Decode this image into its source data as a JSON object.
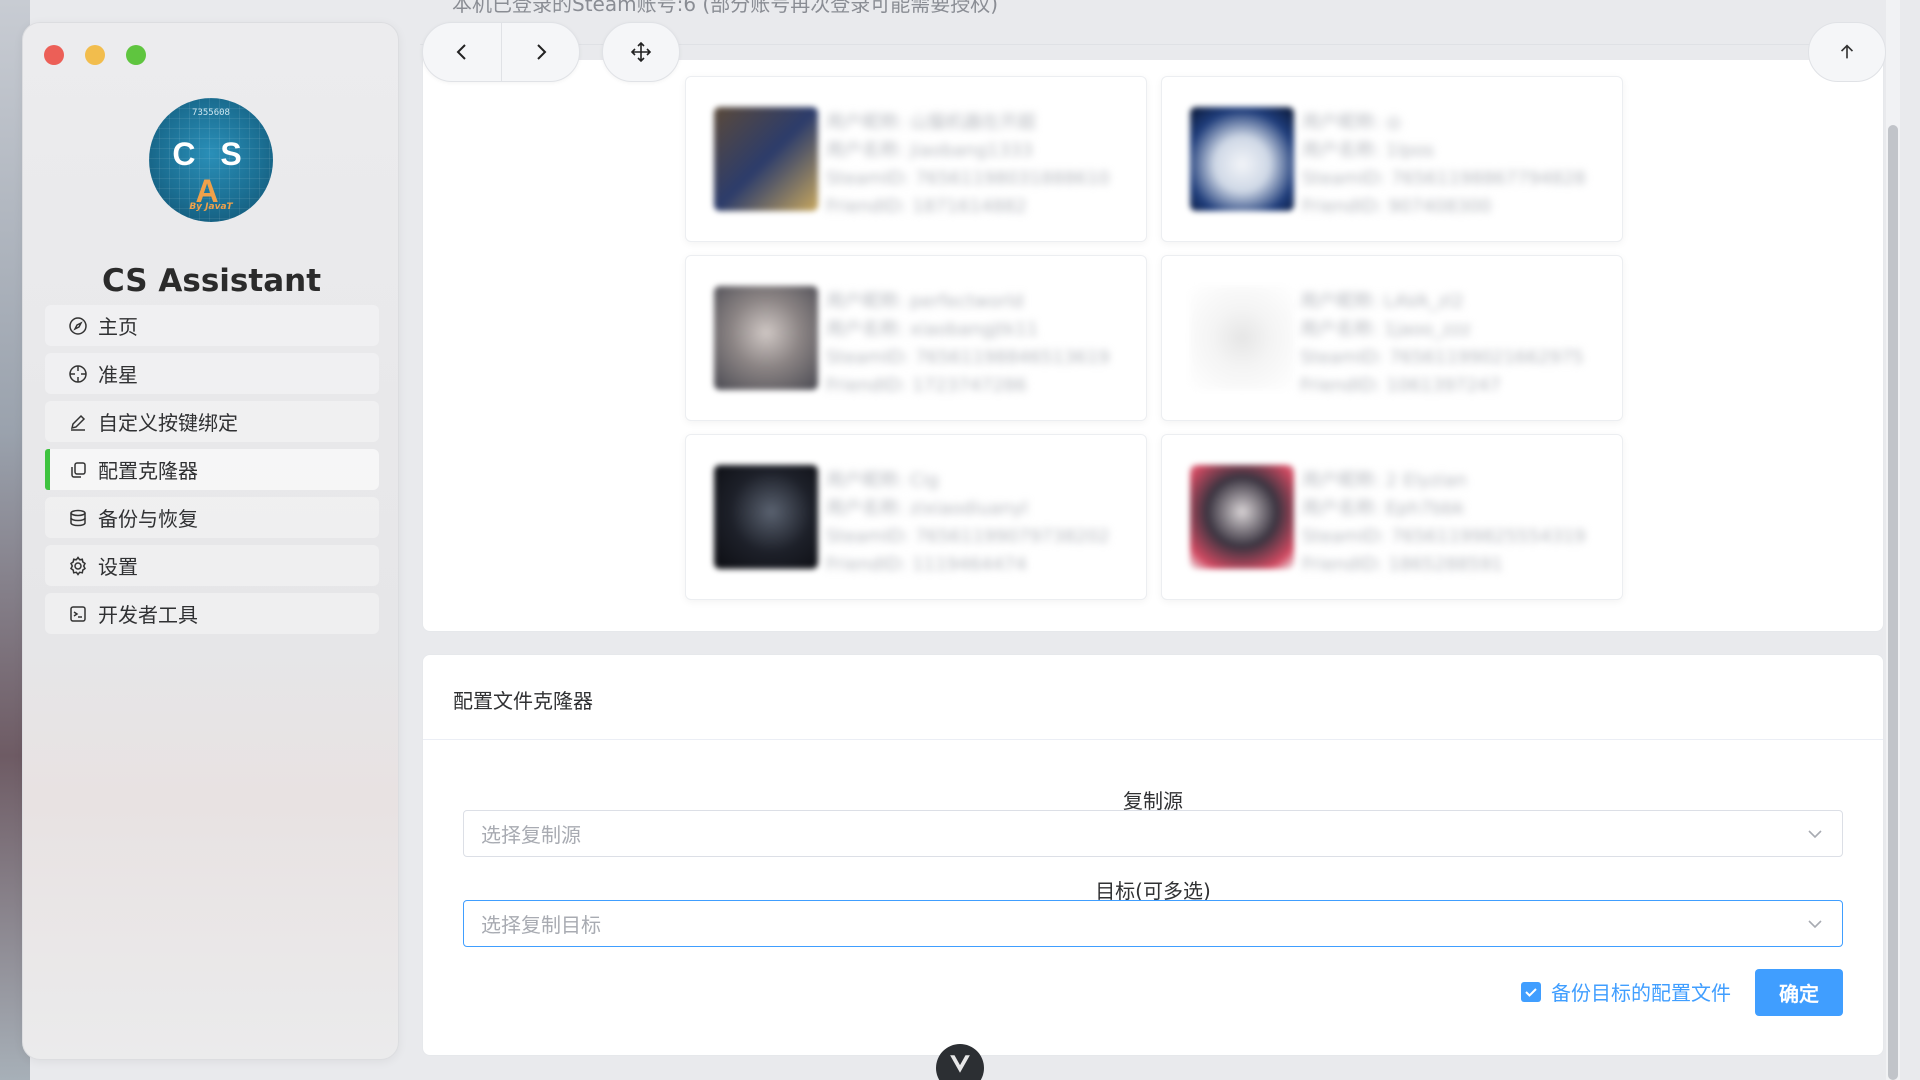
{
  "app": {
    "title": "CS Assistant",
    "logo": {
      "code": "7355608",
      "letters_cs": "C S ",
      "letters_a": "A",
      "byline": "By JavaT"
    }
  },
  "sidebar": {
    "items": [
      {
        "label": "主页",
        "icon": "compass-icon",
        "active": false
      },
      {
        "label": "准星",
        "icon": "crosshair-icon",
        "active": false
      },
      {
        "label": "自定义按键绑定",
        "icon": "pen-icon",
        "active": false
      },
      {
        "label": "配置克隆器",
        "icon": "copy-icon",
        "active": true
      },
      {
        "label": "备份与恢复",
        "icon": "database-icon",
        "active": false
      },
      {
        "label": "设置",
        "icon": "gear-icon",
        "active": false
      },
      {
        "label": "开发者工具",
        "icon": "terminal-icon",
        "active": false
      }
    ]
  },
  "header": {
    "summary": "本机已登录的Steam账号:6 (部分账号再次登录可能需要授权)"
  },
  "accounts": [
    {
      "l1": "用户昵称: 山猫机器在开超",
      "l2": "用户名称: jiaobang1333",
      "l3": "SteamID: 76561198031888610",
      "l4": "FriendID: 1871614882"
    },
    {
      "l1": "用户昵称: ◎",
      "l2": "用户名称: 1lpos",
      "l3": "SteamID: 76561198867794828",
      "l4": "FriendID: 907408300"
    },
    {
      "l1": "用户昵称: perfectworld",
      "l2": "用户名称: xiaobangjtk11",
      "l3": "SteamID: 76561198846513619",
      "l4": "FriendID: 1723747286"
    },
    {
      "l1": "用户昵称: LAVA_zl2",
      "l2": "用户名称: 1jaoo_zzz",
      "l3": "SteamID: 76561199021662975",
      "l4": "FriendID: 1061397247"
    },
    {
      "l1": "用户昵称: Cig",
      "l2": "用户名称: zixiaodiuanyl",
      "l3": "SteamID: 76561199079738202",
      "l4": "FriendID: 1119464474"
    },
    {
      "l1": "用户昵称: 2 Elyzian",
      "l2": "用户名称: Eph7bbk",
      "l3": "SteamID: 76561199825554319",
      "l4": "FriendID: 1865288591"
    }
  ],
  "cloner": {
    "title": "配置文件克隆器",
    "source_label": "复制源",
    "source_placeholder": "选择复制源",
    "target_label": "目标(可多选)",
    "target_placeholder": "选择复制目标",
    "backup_label": "备份目标的配置文件",
    "backup_checked": true,
    "confirm_label": "确定"
  },
  "colors": {
    "accent": "#409eff",
    "active_indicator": "#3ec33f"
  }
}
